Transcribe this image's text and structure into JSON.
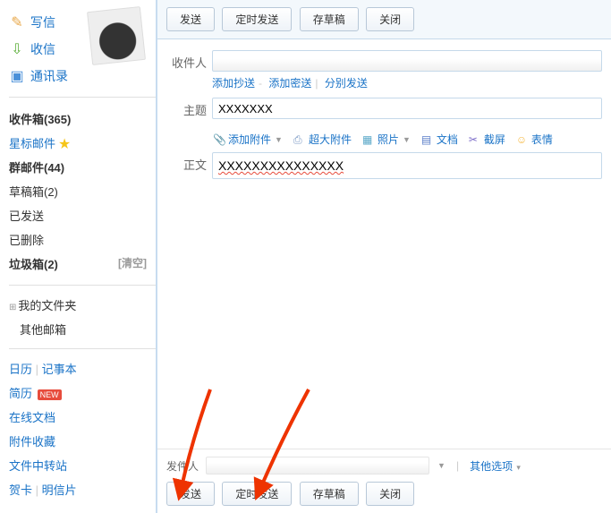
{
  "sidebar": {
    "nav": [
      {
        "label": "写信",
        "icon": "✎"
      },
      {
        "label": "收信",
        "icon": "↓"
      },
      {
        "label": "通讯录",
        "icon": "☖"
      }
    ],
    "folders": {
      "inbox": "收件箱(365)",
      "starred": "星标邮件",
      "group": "群邮件(44)",
      "drafts": "草稿箱(2)",
      "sent": "已发送",
      "deleted": "已删除",
      "trash": "垃圾箱(2)",
      "trash_empty": "[清空]"
    },
    "myfolders_label": "我的文件夹",
    "other_mailbox": "其他邮箱",
    "links": {
      "calendar": "日历",
      "notepad": "记事本",
      "resume": "简历",
      "new_badge": "NEW",
      "online_doc": "在线文档",
      "attach_collect": "附件收藏",
      "file_transfer": "文件中转站",
      "greeting": "贺卡",
      "postcard": "明信片"
    }
  },
  "toolbar": {
    "send": "发送",
    "schedule": "定时发送",
    "draft": "存草稿",
    "close": "关闭"
  },
  "compose": {
    "recipient_label": "收件人",
    "add_cc": "添加抄送",
    "add_bcc": "添加密送",
    "split_send": "分别发送",
    "subject_label": "主题",
    "subject_value": "XXXXXXX",
    "body_label": "正文",
    "body_value": "XXXXXXXXXXXXXXX"
  },
  "attach": {
    "add": "添加附件",
    "big": "超大附件",
    "photo": "照片",
    "doc": "文档",
    "screenshot": "截屏",
    "emoji": "表情"
  },
  "footer": {
    "sender_label": "发件人",
    "other_options": "其他选项"
  }
}
